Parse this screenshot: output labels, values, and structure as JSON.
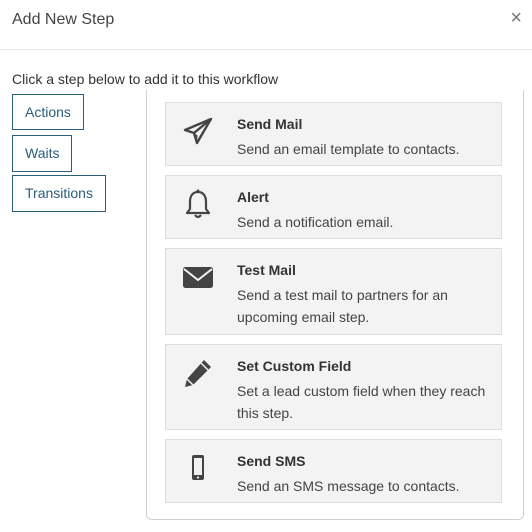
{
  "modal": {
    "title": "Add New Step",
    "close": "×",
    "instruction": "Click a step below to add it to this workflow"
  },
  "tabs": [
    {
      "label": "Actions"
    },
    {
      "label": "Waits"
    },
    {
      "label": "Transitions"
    }
  ],
  "steps": [
    {
      "icon": "paper-plane-icon",
      "name": "Send Mail",
      "description": "Send an email template to contacts."
    },
    {
      "icon": "bell-icon",
      "name": "Alert",
      "description": "Send a notification email."
    },
    {
      "icon": "envelope-icon",
      "name": "Test Mail",
      "description": "Send a test mail to partners for an upcoming email step."
    },
    {
      "icon": "pencil-icon",
      "name": "Set Custom Field",
      "description": "Set a lead custom field when they reach this step."
    },
    {
      "icon": "mobile-phone-icon",
      "name": "Send SMS",
      "description": "Send an SMS message to contacts."
    }
  ],
  "colors": {
    "tab_border": "#2a5d78",
    "card_bg": "#f3f3f3",
    "icon": "#444444"
  }
}
